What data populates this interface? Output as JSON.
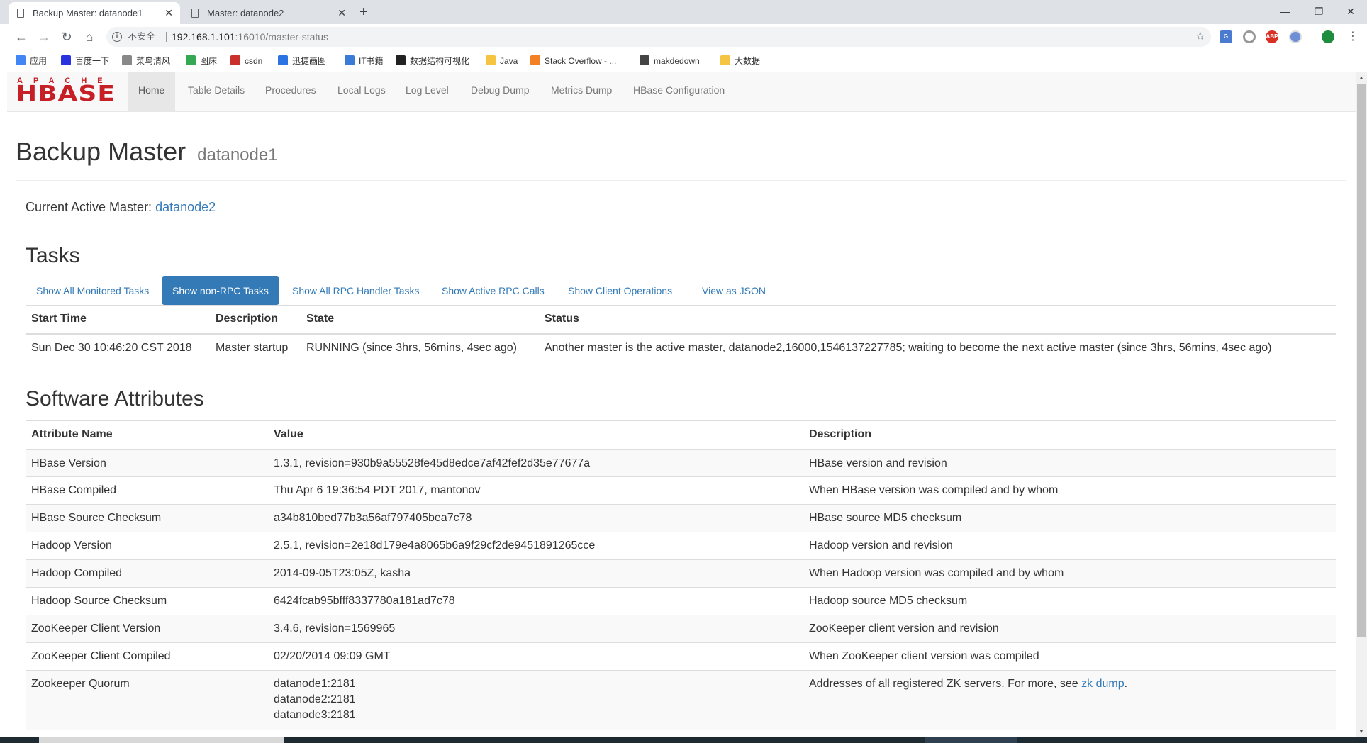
{
  "browser": {
    "tabs": [
      {
        "title": "Backup Master: datanode1",
        "active": true
      },
      {
        "title": "Master: datanode2",
        "active": false
      }
    ],
    "url_host": "192.168.1.101",
    "url_path": ":16010/master-status",
    "insecure_label": "不安全",
    "bookmarks": [
      {
        "label": "应用",
        "color": "#4285f4"
      },
      {
        "label": "百度一下",
        "color": "#2932e1"
      },
      {
        "label": "菜鸟清风",
        "color": "#888888"
      },
      {
        "label": "图床",
        "color": "#34a853"
      },
      {
        "label": "csdn",
        "color": "#c9302c"
      },
      {
        "label": "迅捷画图",
        "color": "#2b73e3"
      },
      {
        "label": "IT书籍",
        "color": "#3a7bd5"
      },
      {
        "label": "数据结构可视化",
        "color": "#222222"
      },
      {
        "label": "Java",
        "color": "#f5c542"
      },
      {
        "label": "Stack Overflow - ...",
        "color": "#f48024"
      },
      {
        "label": "makdedown",
        "color": "#444444"
      },
      {
        "label": "大数据",
        "color": "#f5c542"
      }
    ]
  },
  "nav": {
    "logo_top": "APACHE",
    "logo_main": "HBASE",
    "items": [
      "Home",
      "Table Details",
      "Procedures",
      "Local Logs",
      "Log Level",
      "Debug Dump",
      "Metrics Dump",
      "HBase Configuration"
    ]
  },
  "header": {
    "title": "Backup Master",
    "subtitle": "datanode1"
  },
  "active_master": {
    "label": "Current Active Master: ",
    "link": "datanode2"
  },
  "tasks": {
    "title": "Tasks",
    "pills": [
      "Show All Monitored Tasks",
      "Show non-RPC Tasks",
      "Show All RPC Handler Tasks",
      "Show Active RPC Calls",
      "Show Client Operations",
      "View as JSON"
    ],
    "active_pill": "Show non-RPC Tasks",
    "columns": [
      "Start Time",
      "Description",
      "State",
      "Status"
    ],
    "rows": [
      [
        "Sun Dec 30 10:46:20 CST 2018",
        "Master startup",
        "RUNNING (since 3hrs, 56mins, 4sec ago)",
        "Another master is the active master, datanode2,16000,1546137227785; waiting to become the next active master (since 3hrs, 56mins, 4sec ago)"
      ]
    ]
  },
  "software": {
    "title": "Software Attributes",
    "columns": [
      "Attribute Name",
      "Value",
      "Description"
    ],
    "rows": [
      [
        "HBase Version",
        "1.3.1, revision=930b9a55528fe45d8edce7af42fef2d35e77677a",
        "HBase version and revision"
      ],
      [
        "HBase Compiled",
        "Thu Apr 6 19:36:54 PDT 2017, mantonov",
        "When HBase version was compiled and by whom"
      ],
      [
        "HBase Source Checksum",
        "a34b810bed77b3a56af797405bea7c78",
        "HBase source MD5 checksum"
      ],
      [
        "Hadoop Version",
        "2.5.1, revision=2e18d179e4a8065b6a9f29cf2de9451891265cce",
        "Hadoop version and revision"
      ],
      [
        "Hadoop Compiled",
        "2014-09-05T23:05Z, kasha",
        "When Hadoop version was compiled and by whom"
      ],
      [
        "Hadoop Source Checksum",
        "6424fcab95bfff8337780a181ad7c78",
        "Hadoop source MD5 checksum"
      ],
      [
        "ZooKeeper Client Version",
        "3.4.6, revision=1569965",
        "ZooKeeper client version and revision"
      ],
      [
        "ZooKeeper Client Compiled",
        "02/20/2014 09:09 GMT",
        "When ZooKeeper client version was compiled"
      ]
    ],
    "quorum": {
      "name": "Zookeeper Quorum",
      "servers": [
        "datanode1:2181",
        "datanode2:2181",
        "datanode3:2181"
      ],
      "desc": "Addresses of all registered ZK servers. For more, see ",
      "link": "zk dump",
      "desc_end": "."
    }
  }
}
